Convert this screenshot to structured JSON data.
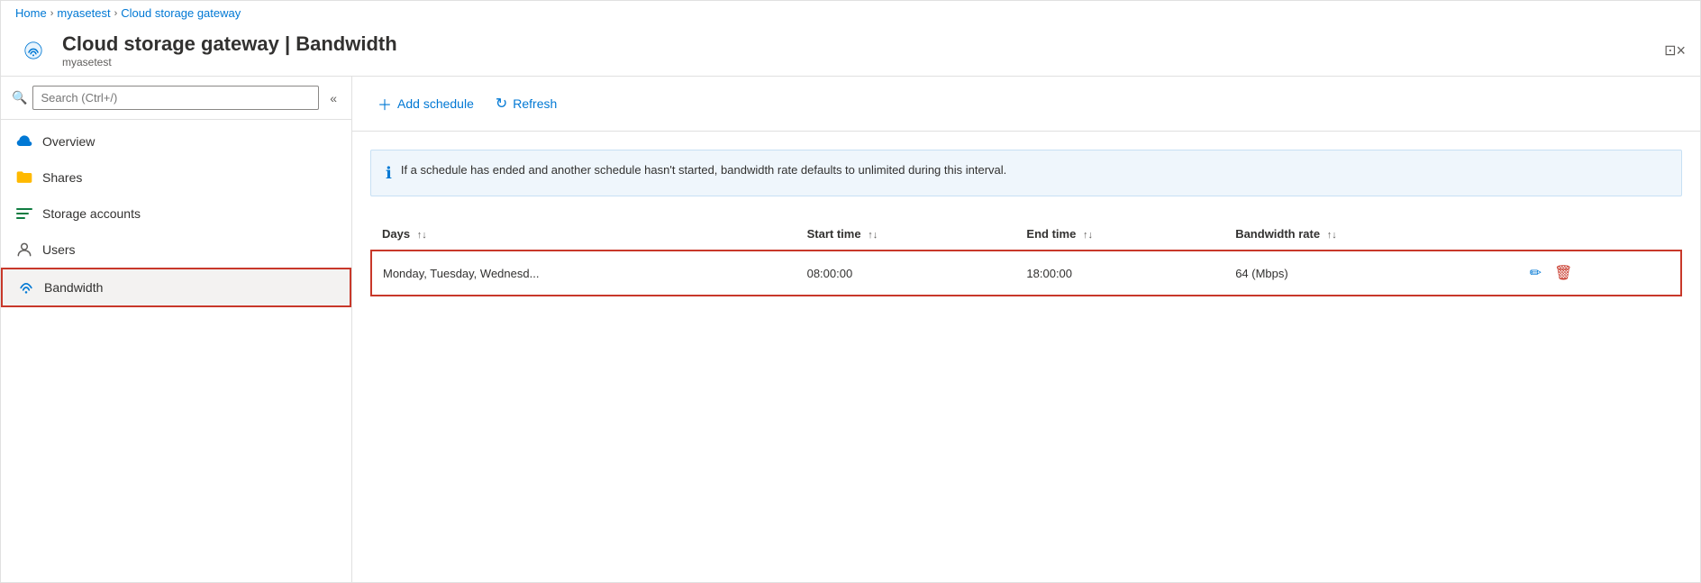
{
  "breadcrumb": {
    "items": [
      "Home",
      "myasetest",
      "Cloud storage gateway"
    ],
    "separators": [
      ">",
      ">"
    ]
  },
  "header": {
    "title": "Cloud storage gateway",
    "page": "Bandwidth",
    "subtitle": "myasetest",
    "print_label": "print",
    "close_label": "×"
  },
  "sidebar": {
    "search_placeholder": "Search (Ctrl+/)",
    "collapse_label": "«",
    "items": [
      {
        "label": "Overview",
        "icon": "cloud-icon"
      },
      {
        "label": "Shares",
        "icon": "folder-icon"
      },
      {
        "label": "Storage accounts",
        "icon": "storage-icon"
      },
      {
        "label": "Users",
        "icon": "user-icon"
      },
      {
        "label": "Bandwidth",
        "icon": "wifi-icon",
        "active": true
      }
    ]
  },
  "toolbar": {
    "add_schedule_label": "Add schedule",
    "refresh_label": "Refresh"
  },
  "info_banner": {
    "text": "If a schedule has ended and another schedule hasn't started, bandwidth rate defaults to unlimited during this interval."
  },
  "table": {
    "columns": [
      {
        "label": "Days",
        "key": "days"
      },
      {
        "label": "Start time",
        "key": "start_time"
      },
      {
        "label": "End time",
        "key": "end_time"
      },
      {
        "label": "Bandwidth rate",
        "key": "bandwidth_rate"
      }
    ],
    "rows": [
      {
        "days": "Monday, Tuesday, Wednesd...",
        "start_time": "08:00:00",
        "end_time": "18:00:00",
        "bandwidth_rate": "64 (Mbps)",
        "selected": true
      }
    ]
  }
}
